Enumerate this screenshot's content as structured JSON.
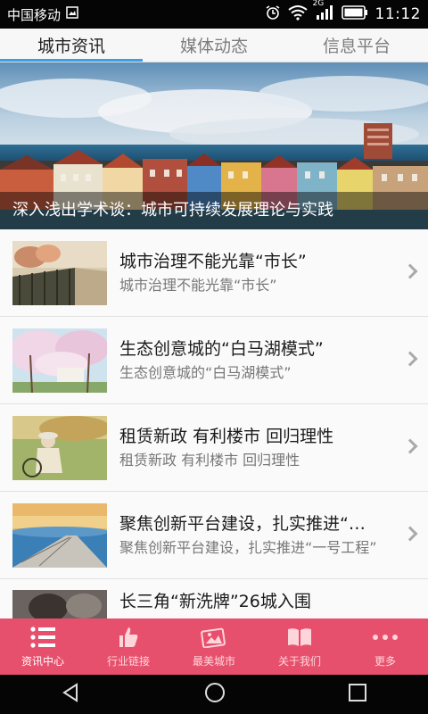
{
  "status_bar": {
    "carrier": "中国移动",
    "network": "2G",
    "time": "11:12"
  },
  "tabs": [
    {
      "label": "城市资讯",
      "active": true
    },
    {
      "label": "媒体动态",
      "active": false
    },
    {
      "label": "信息平台",
      "active": false
    }
  ],
  "banner": {
    "caption": "深入浅出学术谈：城市可持续发展理论与实践"
  },
  "news": [
    {
      "title": "城市治理不能光靠“市长”",
      "subtitle": "城市治理不能光靠“市长”"
    },
    {
      "title": "生态创意城的“白马湖模式”",
      "subtitle": "生态创意城的“白马湖模式”"
    },
    {
      "title": "租赁新政 有利楼市 回归理性",
      "subtitle": "租赁新政 有利楼市 回归理性"
    },
    {
      "title": "聚焦创新平台建设，扎实推进“…",
      "subtitle": "聚焦创新平台建设，扎实推进“一号工程”"
    },
    {
      "title": "长三角“新洗牌”26城入围",
      "subtitle": ""
    }
  ],
  "bottom_nav": [
    {
      "label": "资讯中心",
      "icon": "list-icon",
      "active": true
    },
    {
      "label": "行业链接",
      "icon": "thumbs-up-icon",
      "active": false
    },
    {
      "label": "最美城市",
      "icon": "picture-icon",
      "active": false
    },
    {
      "label": "关于我们",
      "icon": "book-icon",
      "active": false
    },
    {
      "label": "更多",
      "icon": "more-dots-icon",
      "active": false
    }
  ],
  "system_nav": [
    "back-icon",
    "home-icon",
    "recent-apps-icon"
  ],
  "colors": {
    "accent_tab": "#3ba0e6",
    "bottom_nav_bg": "#e7506d",
    "status_bar_bg": "#050505"
  }
}
